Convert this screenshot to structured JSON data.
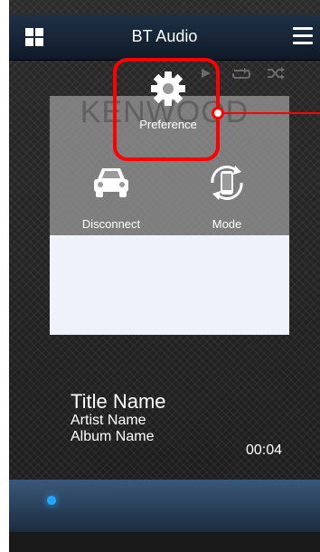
{
  "header": {
    "title": "BT Audio"
  },
  "background": {
    "logo_text": "KENWOOD"
  },
  "menu": {
    "preference": {
      "label": "Preference",
      "icon": "gear-icon"
    },
    "disconnect": {
      "label": "Disconnect",
      "icon": "car-icon"
    },
    "mode": {
      "label": "Mode",
      "icon": "phone-rotate-icon"
    }
  },
  "track": {
    "title": "Title Name",
    "artist": "Artist Name",
    "album": "Album Name",
    "time": "00:04"
  },
  "colors": {
    "highlight": "#ff0000",
    "accent_dot": "#21a6ff",
    "header": "#1f3147",
    "bottom_bar": "#3a5877"
  }
}
